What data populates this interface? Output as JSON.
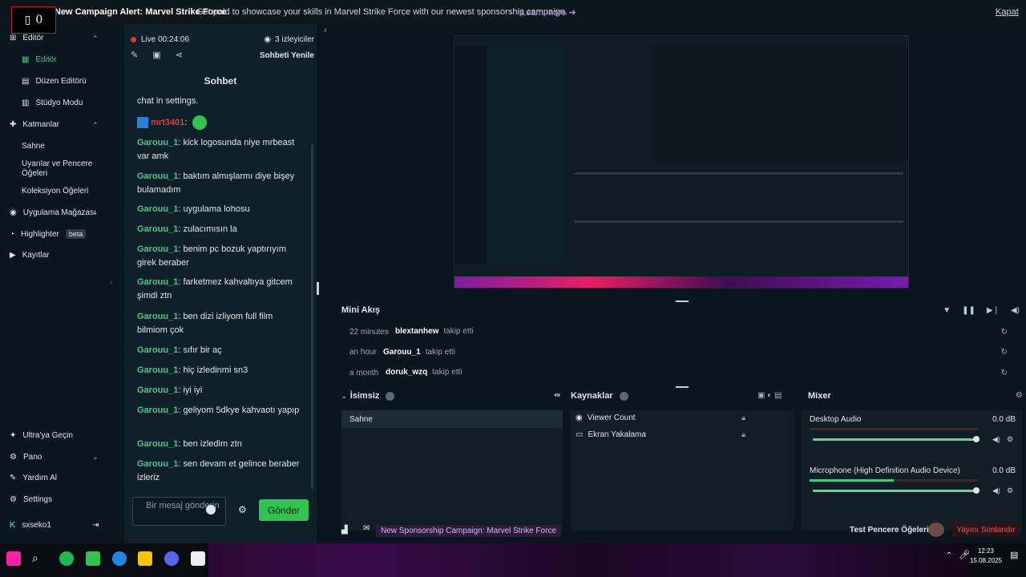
{
  "topbar": {
    "rec_count": "0",
    "alert_title": "New Campaign Alert: Marvel Strike Force",
    "alert_text": "Get paid to showcase your skills in Marvel Strike Force with our newest sponsorship campaign.",
    "learn_more": "Learn more",
    "close": "Kapat"
  },
  "nav": {
    "editor_header": "Editör",
    "editor": "Editör",
    "layout_editor": "Düzen Editörü",
    "studio_mode": "Stüdyo Modu",
    "layers_header": "Katmanlar",
    "scene": "Sahne",
    "alerts_windows": "Uyarılar ve Pencere Öğeleri",
    "collection_items": "Koleksiyon Öğeleri",
    "app_store": "Uygulama Mağazası",
    "highlighter": "Highlighter",
    "beta": "beta",
    "recordings": "Kayıtlar",
    "ultra": "Ultra'ya Geçin",
    "dashboard": "Pano",
    "help": "Yardım Al",
    "settings": "Settings",
    "user": "sxseko1"
  },
  "chat": {
    "live": "Live 00:24:06",
    "viewers": "3 izleyiciler",
    "refresh": "Sohbeti Yenile",
    "title": "Sohbet",
    "partial": "chat in settings.",
    "emote_user": "mrt3401",
    "messages": [
      {
        "user": "Garouu_1",
        "text": "kick logosunda niye mrbeast var amk"
      },
      {
        "user": "Garouu_1",
        "text": "baktım almışlarmı diye bişey bulamadım"
      },
      {
        "user": "Garouu_1",
        "text": "uygulama lohosu"
      },
      {
        "user": "Garouu_1",
        "text": "zulacımısın la"
      },
      {
        "user": "Garouu_1",
        "text": "benim pc bozuk yaptırıyım girek beraber"
      },
      {
        "user": "Garouu_1",
        "text": "farketmez kahvaltıya gitcem şimdi ztn"
      },
      {
        "user": "Garouu_1",
        "text": "ben dizi izliyom full film bilmiom çok"
      },
      {
        "user": "Garouu_1",
        "text": "sıfır bir aç"
      },
      {
        "user": "Garouu_1",
        "text": "hiç izledinmi sn3"
      },
      {
        "user": "Garouu_1",
        "text": "iyi iyi"
      },
      {
        "user": "Garouu_1",
        "text": "geliyom 5dkye kahvaotı yapıp"
      },
      {
        "user": "Garouu_1",
        "text": "ben izledim ztn"
      },
      {
        "user": "Garouu_1",
        "text": "sen devam et gelince beraber izleriz"
      }
    ],
    "input_placeholder": "Bir mesaj gönderin",
    "send": "Gönder"
  },
  "mini_feed": {
    "title": "Mini Akış",
    "rows": [
      {
        "when": "22 minutes",
        "who": "blextanhew",
        "action": "takip etti"
      },
      {
        "when": "an hour",
        "who": "Garouu_1",
        "action": "takip etti"
      },
      {
        "when": "a month",
        "who": "doruk_wzq",
        "action": "takip etti"
      }
    ]
  },
  "scenes": {
    "title": "İsimsiz",
    "items": [
      "Sahne"
    ]
  },
  "sources": {
    "title": "Kaynaklar",
    "items": [
      "Viewer Count",
      "Ekran Yakalama"
    ]
  },
  "mixer": {
    "title": "Mixer",
    "channels": [
      {
        "name": "Desktop Audio",
        "db": "0.0 dB",
        "level": 0.0
      },
      {
        "name": "Microphone (High Definition Audio Device)",
        "db": "0.0 dB",
        "level": 0.5
      }
    ]
  },
  "footer": {
    "campaign": "New Sponsorship Campaign: Marvel Strike Force",
    "test_windows": "Test Pencere Öğeleri",
    "stop_stream": "Yayını Sonlandır"
  },
  "taskbar": {
    "time": "12:23",
    "date": "15.08.2025"
  },
  "colors": {
    "accent_green": "#31c34f",
    "username_green": "#43c888",
    "live_red": "#e23a3a",
    "purple": "#b68cff"
  }
}
